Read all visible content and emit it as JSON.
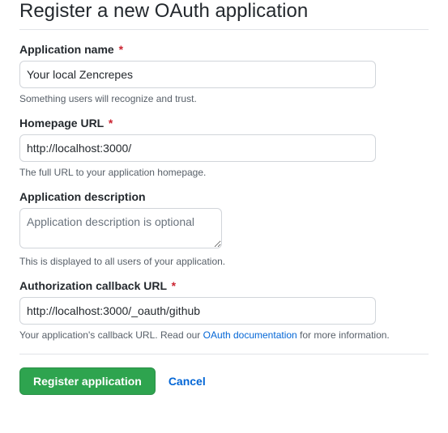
{
  "title": "Register a new OAuth application",
  "fields": {
    "app_name": {
      "label": "Application name",
      "value": "Your local Zencrepes",
      "hint": "Something users will recognize and trust."
    },
    "homepage_url": {
      "label": "Homepage URL",
      "value": "http://localhost:3000/",
      "hint": "The full URL to your application homepage."
    },
    "description": {
      "label": "Application description",
      "placeholder": "Application description is optional",
      "hint": "This is displayed to all users of your application."
    },
    "callback_url": {
      "label": "Authorization callback URL",
      "value": "http://localhost:3000/_oauth/github",
      "hint_prefix": "Your application's callback URL. Read our ",
      "hint_link": "OAuth documentation",
      "hint_suffix": " for more information."
    }
  },
  "actions": {
    "submit": "Register application",
    "cancel": "Cancel"
  },
  "required_marker": "*"
}
